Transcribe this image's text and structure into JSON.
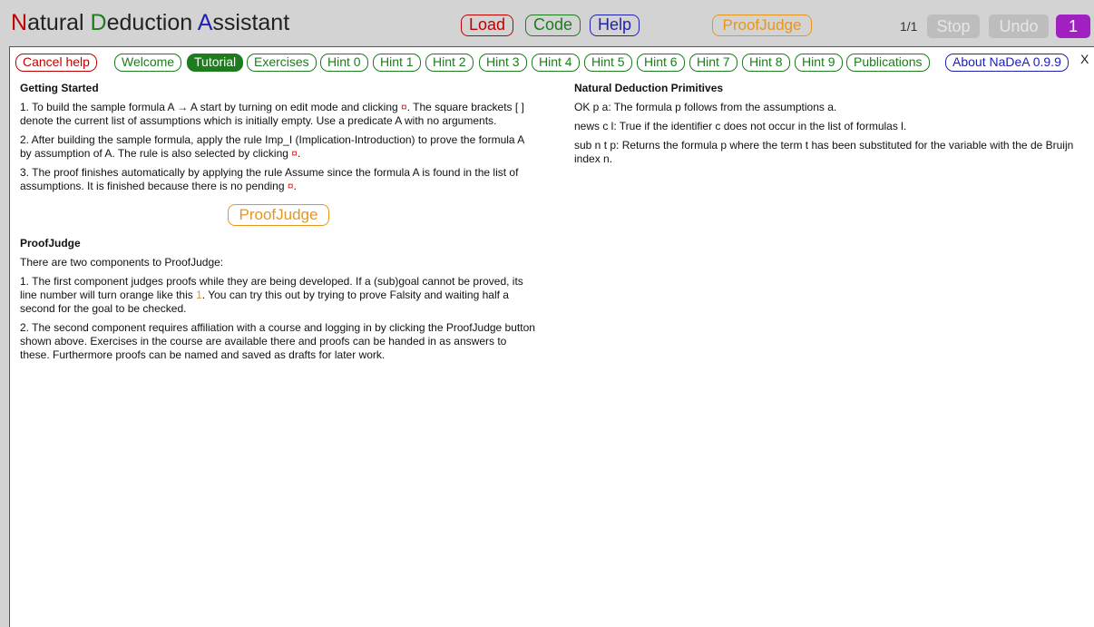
{
  "header": {
    "title_parts": [
      {
        "big": "N",
        "rest": "atural "
      },
      {
        "big": "D",
        "rest": "eduction "
      },
      {
        "big": "A",
        "rest": "ssistant"
      }
    ],
    "load_label": "Load",
    "code_label": "Code",
    "help_label": "Help",
    "proofjudge_label": "ProofJudge",
    "counter": "1/1",
    "stop_label": "Stop",
    "undo_label": "Undo",
    "number_label": "1"
  },
  "nav": {
    "cancel_help": "Cancel help",
    "items": [
      "Welcome",
      "Tutorial",
      "Exercises",
      "Hint 0",
      "Hint 1",
      "Hint 2",
      "Hint 3",
      "Hint 4",
      "Hint 5",
      "Hint 6",
      "Hint 7",
      "Hint 8",
      "Hint 9",
      "Publications"
    ],
    "active": "Tutorial",
    "about": "About NaDeA 0.9.9",
    "close": "X"
  },
  "left": {
    "getting_started_title": "Getting Started",
    "step1_a": "1. To build the sample formula A → A start by turning on edit mode and clicking ",
    "step1_b": ". The square brackets [ ] denote the current list of assumptions which is initially empty. Use a predicate A with no arguments.",
    "step2_a": "2. After building the sample formula, apply the rule Imp_I (Implication-Introduction) to prove the formula A by assumption of A. The rule is also selected by clicking ",
    "step2_b": ".",
    "step3_a": "3. The proof finishes automatically by applying the rule Assume since the formula A is found in the list of assumptions. It is finished because there is no pending ",
    "step3_b": ".",
    "goal_mark": "¤",
    "proofjudge_button": "ProofJudge",
    "proofjudge_title": "ProofJudge",
    "pj_intro": "There are two components to ProofJudge:",
    "pj1_a": "1. The first component judges proofs while they are being developed. If a (sub)goal cannot be proved, its line number will turn orange like this ",
    "pj1_num": "1",
    "pj1_b": ". You can try this out by trying to prove Falsity and waiting half a second for the goal to be checked.",
    "pj2": "2. The second component requires affiliation with a course and logging in by clicking the ProofJudge button shown above. Exercises in the course are available there and proofs can be handed in as answers to these. Furthermore proofs can be named and saved as drafts for later work."
  },
  "right": {
    "title": "Natural Deduction Primitives",
    "lines": [
      "OK p a: The formula p follows from the assumptions a.",
      "news c l: True if the identifier c does not occur in the list of formulas l.",
      "sub n t p: Returns the formula p where the term t has been substituted for the variable with the de Bruijn index n."
    ]
  },
  "colors": {
    "red": "#c00000",
    "green": "#1e7b1e",
    "blue": "#2020b0",
    "orange": "#e6961a",
    "purple": "#a020c0"
  }
}
